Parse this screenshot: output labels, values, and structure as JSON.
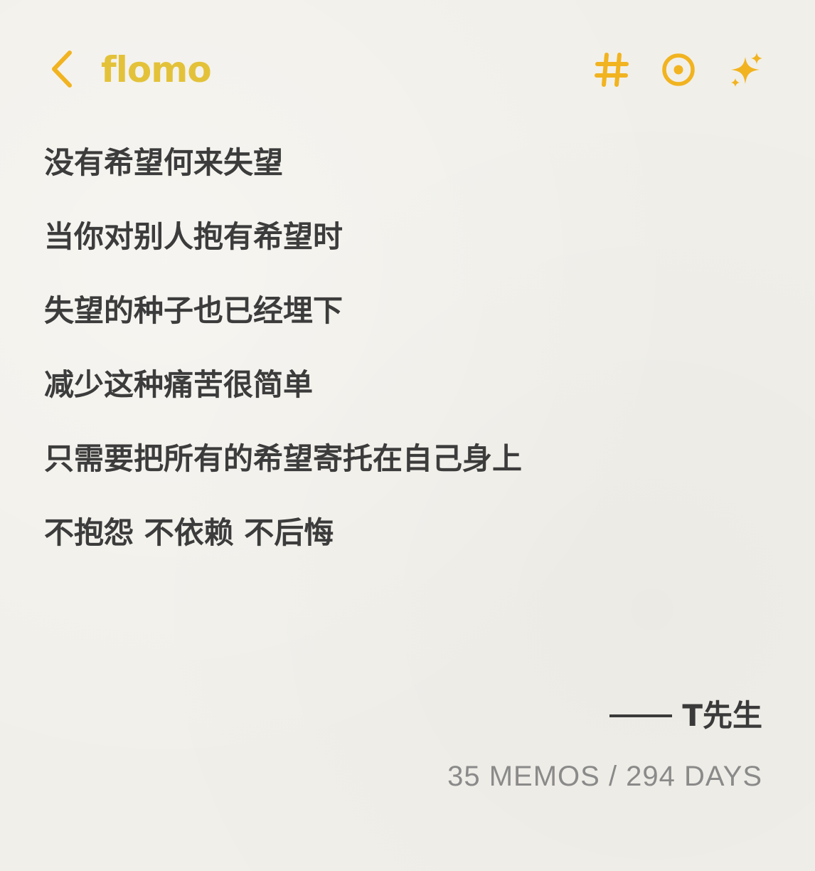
{
  "app": {
    "brand": "flomo",
    "accent_color": "#e3c23a",
    "icon_color": "#f1b320"
  },
  "header": {
    "back_icon": "chevron-left-icon",
    "actions": [
      {
        "icon": "hash-icon"
      },
      {
        "icon": "target-icon"
      },
      {
        "icon": "sparkle-icon"
      }
    ]
  },
  "memo": {
    "lines": [
      "没有希望何来失望",
      "当你对别人抱有希望时",
      "失望的种子也已经埋下",
      "减少这种痛苦很简单",
      "只需要把所有的希望寄托在自己身上",
      "不抱怨 不依赖 不后悔"
    ]
  },
  "signature": {
    "name": "T先生"
  },
  "stats": {
    "text": "35 MEMOS / 294 DAYS"
  }
}
